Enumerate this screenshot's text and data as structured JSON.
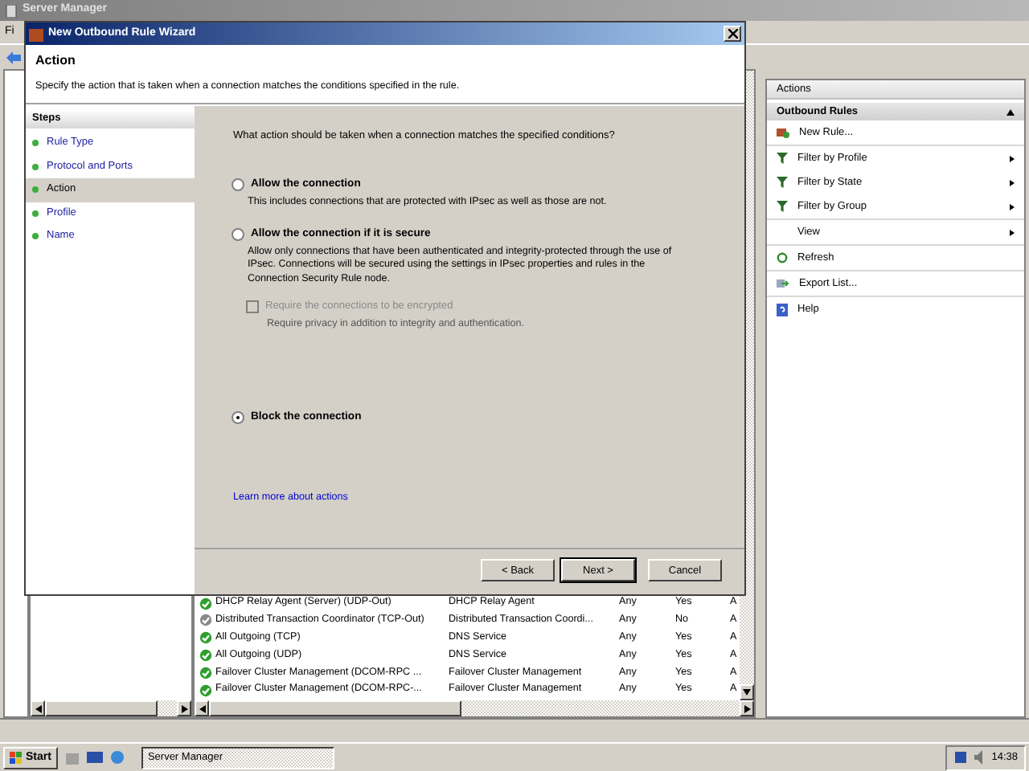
{
  "window": {
    "title": "Server Manager",
    "menu": [
      "Fi"
    ]
  },
  "rules_list": {
    "rows": [
      {
        "name": "DHCP Relay Agent (Server) (UDP-Out)",
        "group": "DHCP Relay Agent",
        "profile": "Any",
        "enabled": true,
        "enabled_text": "Yes",
        "column_5": "A"
      },
      {
        "name": "Distributed Transaction Coordinator (TCP-Out)",
        "group": "Distributed Transaction Coordi...",
        "profile": "Any",
        "enabled": false,
        "enabled_text": "No",
        "column_5": "A"
      },
      {
        "name": "All Outgoing (TCP)",
        "group": "DNS Service",
        "profile": "Any",
        "enabled": true,
        "enabled_text": "Yes",
        "column_5": "A"
      },
      {
        "name": "All Outgoing (UDP)",
        "group": "DNS Service",
        "profile": "Any",
        "enabled": true,
        "enabled_text": "Yes",
        "column_5": "A"
      },
      {
        "name": "Failover Cluster Management (DCOM-RPC ...",
        "group": "Failover Cluster Management",
        "profile": "Any",
        "enabled": true,
        "enabled_text": "Yes",
        "column_5": "A"
      },
      {
        "name": "Failover Cluster Management (DCOM-RPC-...",
        "group": "Failover Cluster Management",
        "profile": "Any",
        "enabled": true,
        "enabled_text": "Yes",
        "column_5": "A"
      }
    ]
  },
  "actions": {
    "title": "Actions",
    "section": "Outbound Rules",
    "items": [
      {
        "label": "New Rule...",
        "kind": "new",
        "submenu": false
      },
      {
        "label": "Filter by Profile",
        "kind": "filter",
        "submenu": true
      },
      {
        "label": "Filter by State",
        "kind": "filter",
        "submenu": true
      },
      {
        "label": "Filter by Group",
        "kind": "filter",
        "submenu": true
      },
      {
        "label": "View",
        "kind": "plain",
        "submenu": true
      },
      {
        "label": "Refresh",
        "kind": "refresh",
        "submenu": false
      },
      {
        "label": "Export List...",
        "kind": "export",
        "submenu": false
      },
      {
        "label": "Help",
        "kind": "help",
        "submenu": false
      }
    ]
  },
  "wizard": {
    "title": "New Outbound Rule Wizard",
    "heading": "Action",
    "description": "Specify the action that is taken when a connection matches the conditions specified in the rule.",
    "steps_title": "Steps",
    "steps": [
      {
        "label": "Rule Type",
        "selected": false
      },
      {
        "label": "Protocol and Ports",
        "selected": false
      },
      {
        "label": "Action",
        "selected": true
      },
      {
        "label": "Profile",
        "selected": false
      },
      {
        "label": "Name",
        "selected": false
      }
    ],
    "question": "What action should be taken when a connection matches the specified conditions?",
    "options": [
      {
        "label": "Allow the connection",
        "description": "This includes connections that are protected with IPsec as well as those are not.",
        "selected": false
      },
      {
        "label": "Allow the connection if it is secure",
        "description": "Allow only connections that have been authenticated and integrity-protected through the use of IPsec. Connections will be secured using the settings in IPsec properties and rules in the Connection Security Rule node.",
        "selected": false,
        "sub_option": {
          "label": "Require the connections to be encrypted",
          "description": "Require privacy in addition to integrity and authentication.",
          "checked": false,
          "disabled": true
        }
      },
      {
        "label": "Block the connection",
        "selected": true
      }
    ],
    "link": "Learn more about actions",
    "buttons": [
      "< Back",
      "Next >",
      "Cancel"
    ]
  },
  "taskbar": {
    "start": "Start",
    "task": "Server Manager",
    "clock": "14:38"
  }
}
